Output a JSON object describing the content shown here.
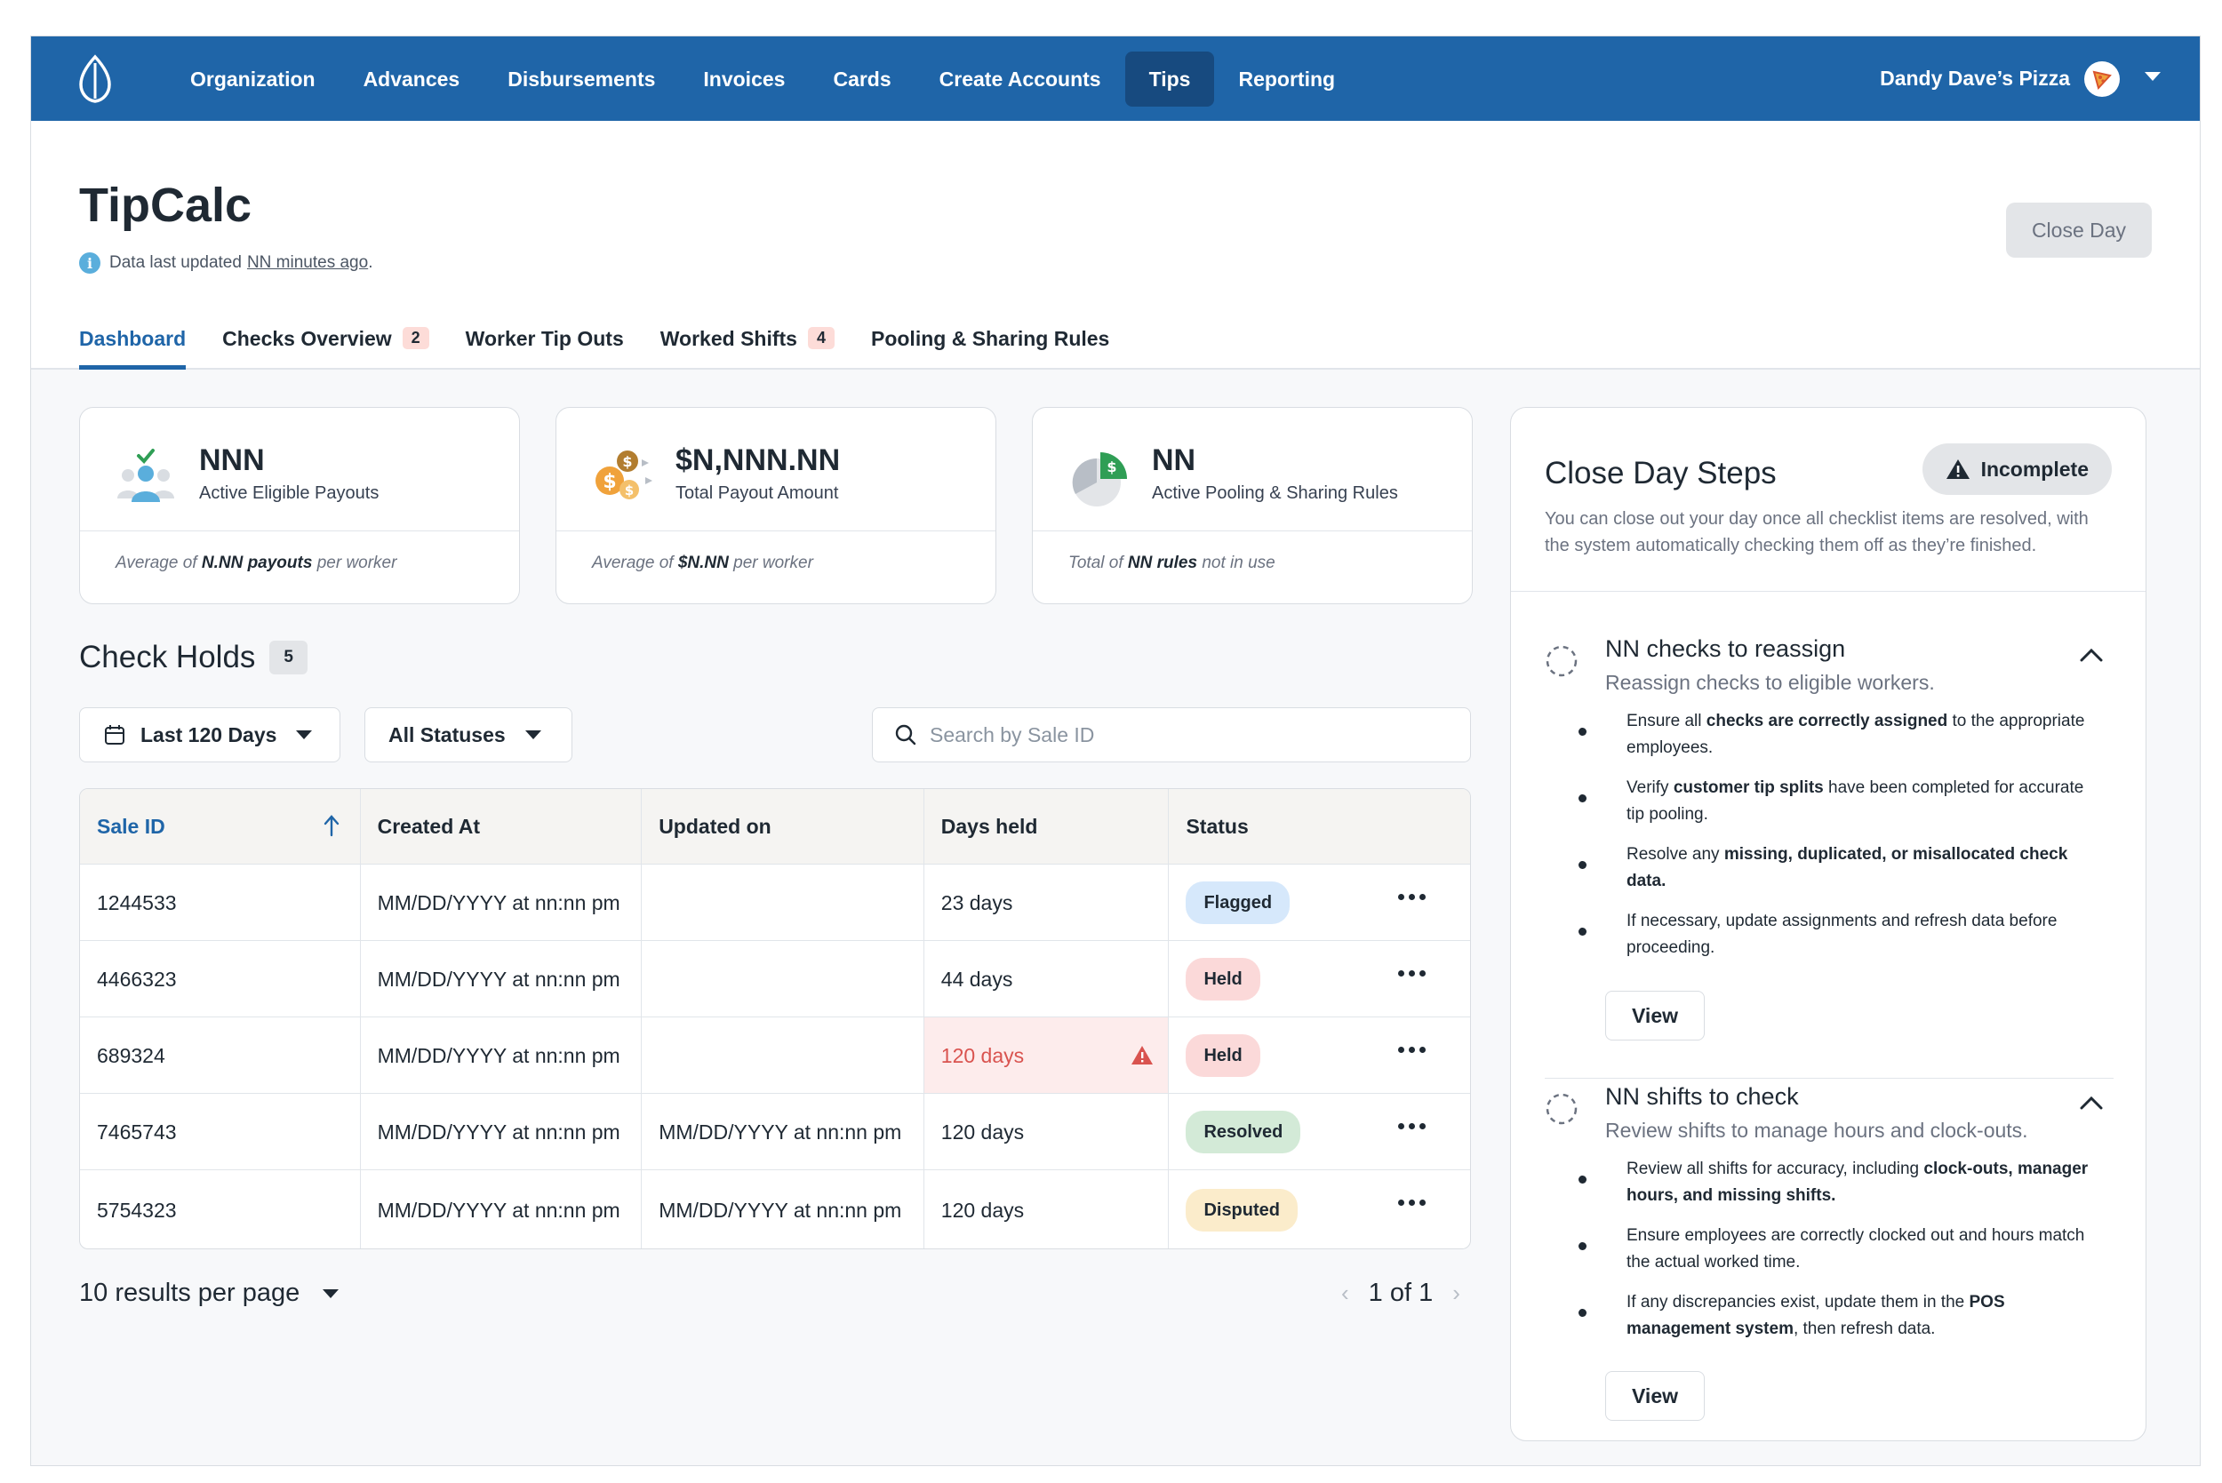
{
  "nav": {
    "items": [
      {
        "label": "Organization",
        "active": false
      },
      {
        "label": "Advances",
        "active": false
      },
      {
        "label": "Disbursements",
        "active": false
      },
      {
        "label": "Invoices",
        "active": false
      },
      {
        "label": "Cards",
        "active": false
      },
      {
        "label": "Create Accounts",
        "active": false
      },
      {
        "label": "Tips",
        "active": true
      },
      {
        "label": "Reporting",
        "active": false
      }
    ],
    "account_name": "Dandy Dave’s Pizza"
  },
  "page": {
    "title": "TipCalc",
    "updated_prefix": "Data last updated",
    "updated_link": "NN minutes ago",
    "updated_suffix": ".",
    "close_day_label": "Close Day"
  },
  "tabs": [
    {
      "label": "Dashboard",
      "badge": "",
      "active": true
    },
    {
      "label": "Checks Overview",
      "badge": "2",
      "active": false
    },
    {
      "label": "Worker Tip Outs",
      "badge": "",
      "active": false
    },
    {
      "label": "Worked Shifts",
      "badge": "4",
      "active": false
    },
    {
      "label": "Pooling & Sharing Rules",
      "badge": "",
      "active": false
    }
  ],
  "stats": [
    {
      "value": "NNN",
      "label": "Active Eligible Payouts",
      "foot_pre": "Average of",
      "foot_bold": "N.NN payouts",
      "foot_post": "per worker",
      "icon": "users-check-icon"
    },
    {
      "value": "$N,NNN.NN",
      "label": "Total Payout Amount",
      "foot_pre": "Average of",
      "foot_bold": "$N.NN",
      "foot_post": "per worker",
      "icon": "coins-icon"
    },
    {
      "value": "NN",
      "label": "Active Pooling & Sharing Rules",
      "foot_pre": "Total of",
      "foot_bold": "NN rules",
      "foot_post": "not in use",
      "icon": "pie-dollar-icon"
    }
  ],
  "check_holds": {
    "title": "Check Holds",
    "count": "5",
    "filter_date": "Last 120 Days",
    "filter_status": "All Statuses",
    "search_placeholder": "Search by Sale ID",
    "columns": [
      "Sale ID",
      "Created At",
      "Updated on",
      "Days held",
      "Status"
    ],
    "rows": [
      {
        "sale_id": "1244533",
        "created": "MM/DD/YYYY at nn:nn pm",
        "updated": "",
        "days": "23 days",
        "status": "Flagged",
        "status_kind": "flagged",
        "alert": false
      },
      {
        "sale_id": "4466323",
        "created": "MM/DD/YYYY at nn:nn pm",
        "updated": "",
        "days": "44 days",
        "status": "Held",
        "status_kind": "held",
        "alert": false
      },
      {
        "sale_id": "689324",
        "created": "MM/DD/YYYY at nn:nn pm",
        "updated": "",
        "days": "120 days",
        "status": "Held",
        "status_kind": "held",
        "alert": true
      },
      {
        "sale_id": "7465743",
        "created": "MM/DD/YYYY at nn:nn pm",
        "updated": "MM/DD/YYYY at nn:nn pm",
        "days": "120 days",
        "status": "Resolved",
        "status_kind": "resolved",
        "alert": false
      },
      {
        "sale_id": "5754323",
        "created": "MM/DD/YYYY at nn:nn pm",
        "updated": "MM/DD/YYYY at nn:nn pm",
        "days": "120 days",
        "status": "Disputed",
        "status_kind": "disputed",
        "alert": false
      }
    ],
    "per_page": "10 results per page",
    "pagination": "1 of 1"
  },
  "close_day_steps": {
    "title": "Close Day Steps",
    "status": "Incomplete",
    "description": "You can close out your day once all checklist items are resolved, with the system automatically checking them off as they’re finished.",
    "groups": [
      {
        "title": "NN checks to reassign",
        "subtitle": "Reassign checks to eligible workers.",
        "bullets": [
          {
            "parts": [
              {
                "t": "Ensure all ",
                "b": false
              },
              {
                "t": "checks are correctly assigned",
                "b": true
              },
              {
                "t": " to the appropriate employees.",
                "b": false
              }
            ]
          },
          {
            "parts": [
              {
                "t": "Verify ",
                "b": false
              },
              {
                "t": "customer tip splits",
                "b": true
              },
              {
                "t": " have been completed for accurate tip pooling.",
                "b": false
              }
            ]
          },
          {
            "parts": [
              {
                "t": "Resolve any ",
                "b": false
              },
              {
                "t": "missing, duplicated, or misallocated check data.",
                "b": true
              }
            ]
          },
          {
            "parts": [
              {
                "t": "If necessary, update assignments and refresh data before proceeding.",
                "b": false
              }
            ]
          }
        ],
        "view_label": "View"
      },
      {
        "title": "NN shifts to check",
        "subtitle": "Review shifts to manage hours and clock-outs.",
        "bullets": [
          {
            "parts": [
              {
                "t": "Review all shifts for accuracy, including ",
                "b": false
              },
              {
                "t": "clock-outs, manager hours, and missing shifts.",
                "b": true
              }
            ]
          },
          {
            "parts": [
              {
                "t": "Ensure employees are correctly clocked out and hours match the actual worked time.",
                "b": false
              }
            ]
          },
          {
            "parts": [
              {
                "t": "If any discrepancies exist, update them in the ",
                "b": false
              },
              {
                "t": "POS management system",
                "b": true
              },
              {
                "t": ", then refresh data.",
                "b": false
              }
            ]
          }
        ],
        "view_label": "View"
      }
    ]
  },
  "colors": {
    "nav_bg": "#1f65a8",
    "nav_active": "#174a7f",
    "accent": "#1f65a8",
    "flagged": "#d6e8fb",
    "held": "#fbd9d9",
    "resolved": "#d3ead7",
    "disputed": "#fbeccb",
    "alert_text": "#d9534f"
  }
}
